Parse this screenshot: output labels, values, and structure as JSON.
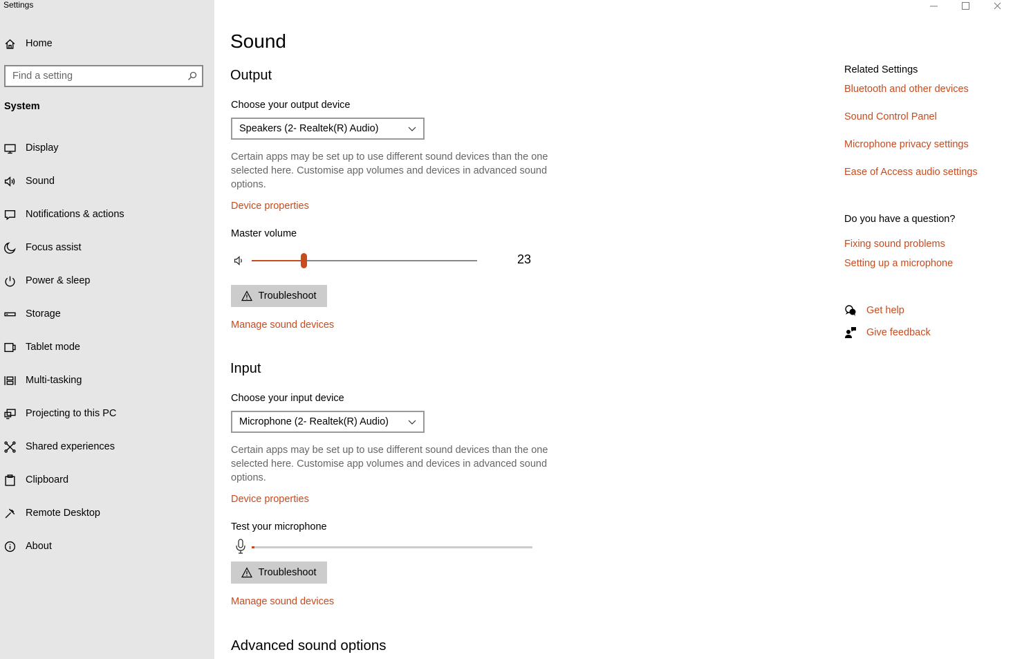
{
  "app": {
    "title": "Settings"
  },
  "sidebar": {
    "home_label": "Home",
    "search_placeholder": "Find a setting",
    "section": "System",
    "items": [
      {
        "label": "Display",
        "icon": "monitor-icon"
      },
      {
        "label": "Sound",
        "icon": "speaker-icon"
      },
      {
        "label": "Notifications & actions",
        "icon": "notification-icon"
      },
      {
        "label": "Focus assist",
        "icon": "moon-icon"
      },
      {
        "label": "Power & sleep",
        "icon": "power-icon"
      },
      {
        "label": "Storage",
        "icon": "storage-icon"
      },
      {
        "label": "Tablet mode",
        "icon": "tablet-icon"
      },
      {
        "label": "Multi-tasking",
        "icon": "multitasking-icon"
      },
      {
        "label": "Projecting to this PC",
        "icon": "projector-icon"
      },
      {
        "label": "Shared experiences",
        "icon": "shared-icon"
      },
      {
        "label": "Clipboard",
        "icon": "clipboard-icon"
      },
      {
        "label": "Remote Desktop",
        "icon": "remote-icon"
      },
      {
        "label": "About",
        "icon": "info-icon"
      }
    ]
  },
  "main": {
    "title": "Sound",
    "output": {
      "heading": "Output",
      "device_label": "Choose your output device",
      "device_value": "Speakers (2- Realtek(R) Audio)",
      "description": "Certain apps may be set up to use different sound devices than the one selected here. Customise app volumes and devices in advanced sound options.",
      "device_properties": "Device properties",
      "volume_label": "Master volume",
      "volume_value": "23",
      "volume_level": 0.23,
      "troubleshoot": "Troubleshoot",
      "manage": "Manage sound devices"
    },
    "input": {
      "heading": "Input",
      "device_label": "Choose your input device",
      "device_value": "Microphone (2- Realtek(R) Audio)",
      "description": "Certain apps may be set up to use different sound devices than the one selected here. Customise app volumes and devices in advanced sound options.",
      "device_properties": "Device properties",
      "test_label": "Test your microphone",
      "mic_level": 0.01,
      "troubleshoot": "Troubleshoot",
      "manage": "Manage sound devices"
    },
    "advanced_heading": "Advanced sound options"
  },
  "related": {
    "heading": "Related Settings",
    "links": [
      "Bluetooth and other devices",
      "Sound Control Panel",
      "Microphone privacy settings",
      "Ease of Access audio settings"
    ],
    "question_heading": "Do you have a question?",
    "question_links": [
      "Fixing sound problems",
      "Setting up a microphone"
    ],
    "get_help": "Get help",
    "give_feedback": "Give feedback"
  },
  "colors": {
    "accent": "#c84b1e",
    "sidebar_bg": "#e6e6e6",
    "button_bg": "#cccccc"
  }
}
